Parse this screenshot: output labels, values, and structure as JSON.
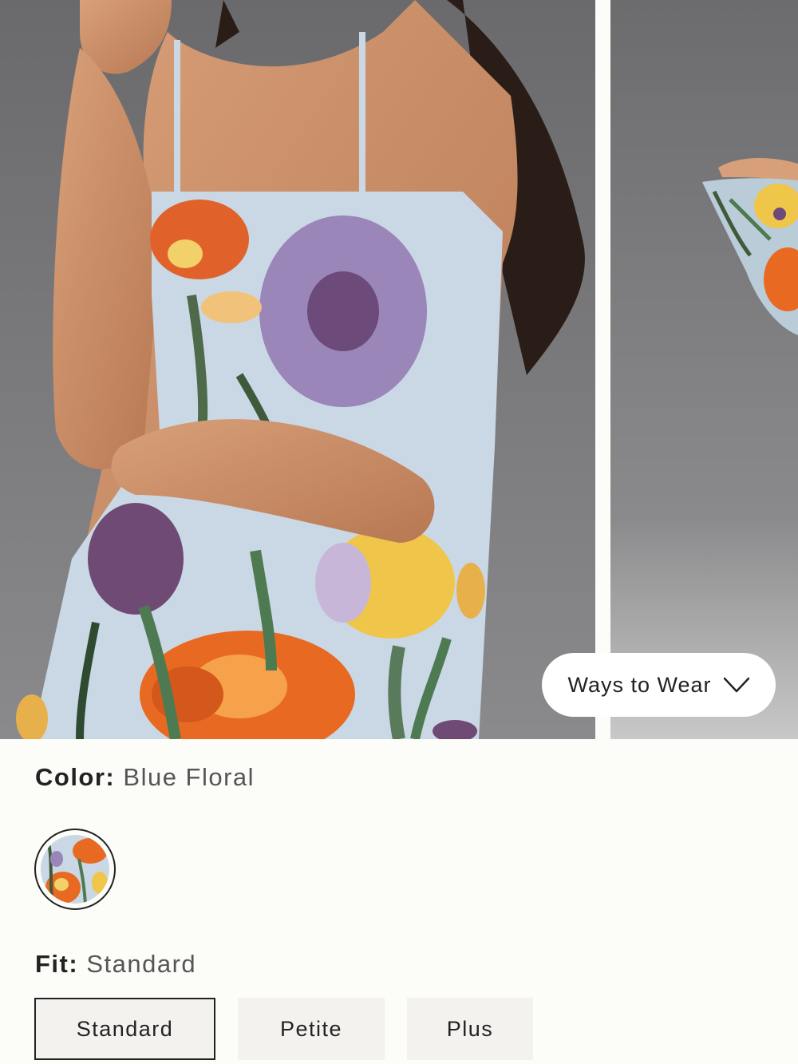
{
  "gallery": {
    "ways_to_wear_label": "Ways to Wear"
  },
  "color": {
    "label": "Color:",
    "value": "Blue Floral"
  },
  "fit": {
    "label": "Fit:",
    "value": "Standard",
    "options": [
      "Standard",
      "Petite",
      "Plus"
    ],
    "selected": "Standard"
  },
  "colors": {
    "background": "#fcfcf9",
    "dress_blue": "#c9d8e4",
    "option_bg": "#f4f2ef",
    "text": "#222222"
  }
}
